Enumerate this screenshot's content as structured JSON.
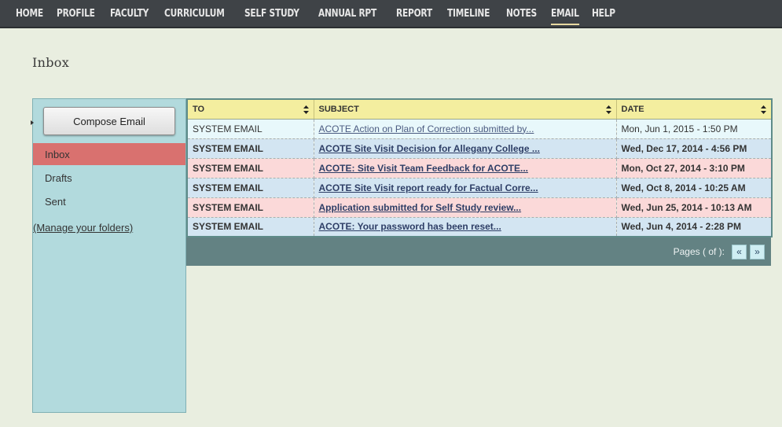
{
  "nav": {
    "items": [
      "HOME",
      "PROFILE",
      "FACULTY",
      "CURRICULUM",
      "SELF STUDY",
      "ANNUAL RPT",
      "REPORT",
      "TIMELINE",
      "NOTES",
      "EMAIL",
      "HELP"
    ],
    "active": "EMAIL"
  },
  "page": {
    "title": "Inbox"
  },
  "sidebar": {
    "compose_label": "Compose Email",
    "folders": [
      "Inbox",
      "Drafts",
      "Sent"
    ],
    "active_folder": "Inbox",
    "manage_label": "(Manage your folders)"
  },
  "table": {
    "headers": {
      "to": "TO",
      "subject": "SUBJECT",
      "date": "DATE"
    },
    "rows": [
      {
        "to": "SYSTEM EMAIL",
        "subject": "ACOTE Action on Plan of Correction submitted by...",
        "date": "Mon, Jun 1, 2015 - 1:50 PM",
        "state": "read"
      },
      {
        "to": "SYSTEM EMAIL",
        "subject": "ACOTE Site Visit Decision for Allegany College ...",
        "date": "Wed, Dec 17, 2014 - 4:56 PM",
        "state": "unread-blue"
      },
      {
        "to": "SYSTEM EMAIL",
        "subject": "ACOTE: Site Visit Team Feedback for ACOTE...",
        "date": "Mon, Oct 27, 2014 - 3:10 PM",
        "state": "unread-pink"
      },
      {
        "to": "SYSTEM EMAIL",
        "subject": "ACOTE Site Visit report ready for Factual Corre...",
        "date": "Wed, Oct 8, 2014 - 10:25 AM",
        "state": "unread-blue"
      },
      {
        "to": "SYSTEM EMAIL",
        "subject": "Application submitted for Self Study review...",
        "date": "Wed, Jun 25, 2014 - 10:13 AM",
        "state": "unread-pink"
      },
      {
        "to": "SYSTEM EMAIL",
        "subject": "ACOTE: Your password has been reset...",
        "date": "Wed, Jun 4, 2014 - 2:28 PM",
        "state": "unread-blue"
      }
    ]
  },
  "pager": {
    "label": "Pages ( of ):",
    "prev": "«",
    "next": "»"
  },
  "colors": {
    "nav_bg": "#3f4347",
    "page_bg": "#e9eee0",
    "sidebar_bg": "#b2dadd",
    "active_folder": "#d9716f",
    "header_bg": "#f4ee9f",
    "row_read": "#e8f8fb",
    "row_blue": "#d3e5f2",
    "row_pink": "#fbd9d9",
    "pager_bg": "#638283"
  }
}
